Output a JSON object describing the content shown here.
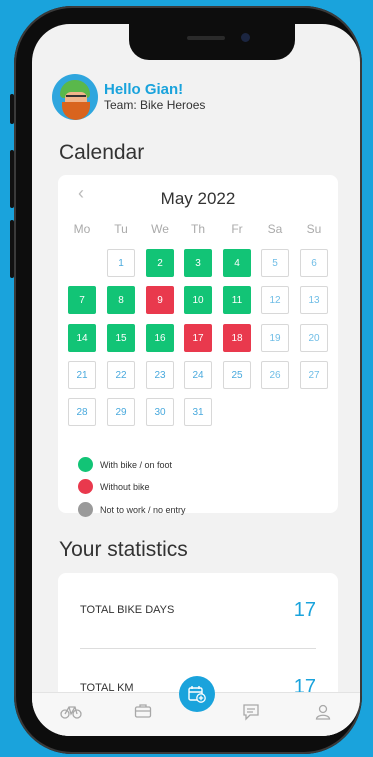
{
  "user": {
    "greeting": "Hello Gian!",
    "team": "Team: Bike Heroes"
  },
  "calendar": {
    "title": "Calendar",
    "month": "May 2022",
    "prev_icon": "chevron-left-icon",
    "weekdays": [
      "Mo",
      "Tu",
      "We",
      "Th",
      "Fr",
      "Sa",
      "Su"
    ],
    "weeks": [
      [
        null,
        {
          "d": "1",
          "s": "empty"
        },
        {
          "d": "2",
          "s": "green"
        },
        {
          "d": "3",
          "s": "green"
        },
        {
          "d": "4",
          "s": "green"
        },
        {
          "d": "5",
          "s": "weekend"
        },
        {
          "d": "6",
          "s": "weekend"
        }
      ],
      [
        {
          "d": "7",
          "s": "green"
        },
        {
          "d": "8",
          "s": "green"
        },
        {
          "d": "9",
          "s": "red"
        },
        {
          "d": "10",
          "s": "green"
        },
        {
          "d": "11",
          "s": "green"
        },
        {
          "d": "12",
          "s": "weekend"
        },
        {
          "d": "13",
          "s": "weekend"
        }
      ],
      [
        {
          "d": "14",
          "s": "green"
        },
        {
          "d": "15",
          "s": "green"
        },
        {
          "d": "16",
          "s": "green"
        },
        {
          "d": "17",
          "s": "red"
        },
        {
          "d": "18",
          "s": "red"
        },
        {
          "d": "19",
          "s": "weekend"
        },
        {
          "d": "20",
          "s": "weekend"
        }
      ],
      [
        {
          "d": "21",
          "s": "empty"
        },
        {
          "d": "22",
          "s": "empty"
        },
        {
          "d": "23",
          "s": "empty"
        },
        {
          "d": "24",
          "s": "empty"
        },
        {
          "d": "25",
          "s": "empty"
        },
        {
          "d": "26",
          "s": "weekend"
        },
        {
          "d": "27",
          "s": "weekend"
        }
      ],
      [
        {
          "d": "28",
          "s": "empty"
        },
        {
          "d": "29",
          "s": "empty"
        },
        {
          "d": "30",
          "s": "empty"
        },
        {
          "d": "31",
          "s": "empty"
        },
        null,
        null,
        null
      ]
    ],
    "legend": [
      {
        "label": "With bike / on foot",
        "color": "#12c476"
      },
      {
        "label": "Without bike",
        "color": "#e9394d"
      },
      {
        "label": "Not to work / no entry",
        "color": "#9a9a9a"
      }
    ]
  },
  "statistics": {
    "title": "Your statistics",
    "items": [
      {
        "label": "TOTAL BIKE DAYS",
        "value": "17"
      },
      {
        "label": "TOTAL KM",
        "value": "17"
      }
    ]
  },
  "tabbar": {
    "icons": [
      "bike-icon",
      "briefcase-icon",
      "calendar-add-icon",
      "chat-icon",
      "profile-icon"
    ]
  },
  "colors": {
    "accent": "#1aa3dc",
    "green": "#12c476",
    "red": "#e9394d",
    "grey": "#9a9a9a"
  }
}
